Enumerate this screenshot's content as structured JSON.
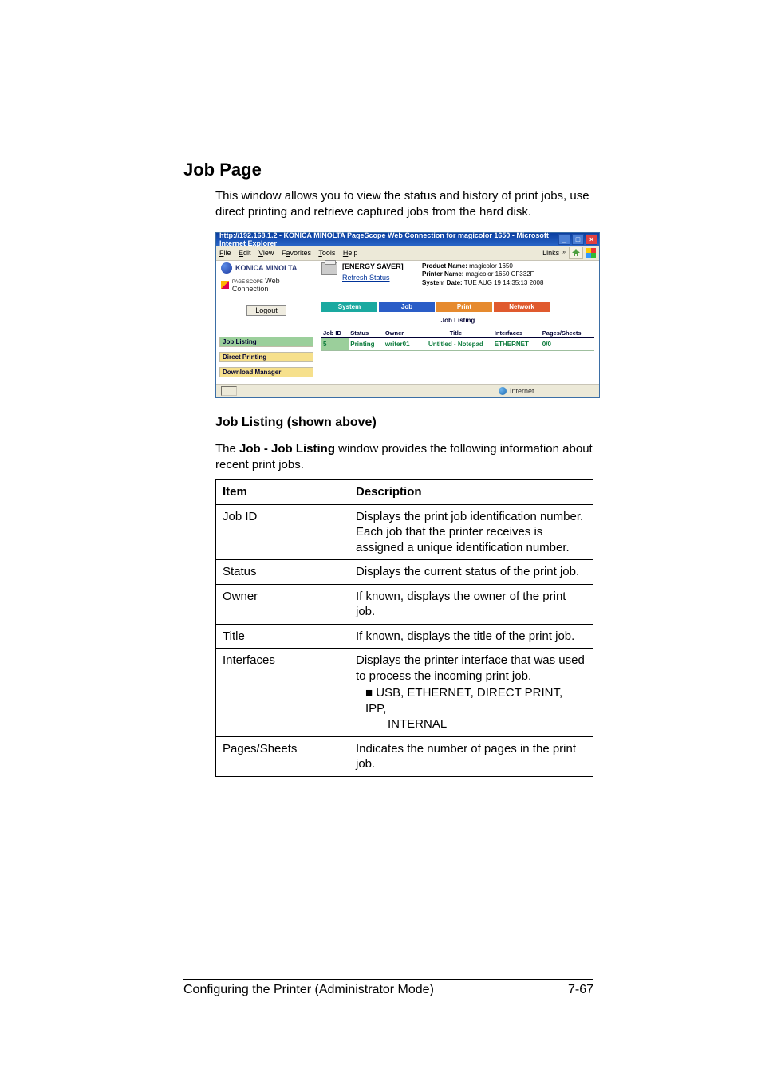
{
  "heading": "Job Page",
  "intro": "This window allows you to view the status and history of print jobs, use direct printing and retrieve captured jobs from the hard disk.",
  "screenshot": {
    "title": "http://192.168.1.2 - KONICA MINOLTA PageScope Web Connection for magicolor 1650 - Microsoft Internet Explorer",
    "menu": {
      "file": "File",
      "edit": "Edit",
      "view": "View",
      "favorites": "Favorites",
      "tools": "Tools",
      "help": "Help",
      "links": "Links"
    },
    "brand": {
      "km": "KONICA MINOLTA",
      "webconn": "Web Connection",
      "pagescope": "PAGE SCOPE"
    },
    "status_block": {
      "label": "[ENERGY SAVER]",
      "refresh": "Refresh Status"
    },
    "info": {
      "product_label": "Product Name:",
      "product": "magicolor 1650",
      "printer_label": "Printer Name:",
      "printer": "magicolor 1650 CF332F",
      "date_label": "System Date:",
      "date": "TUE AUG 19 14:35:13 2008"
    },
    "side": {
      "logout": "Logout",
      "job_listing": "Job Listing",
      "direct_printing": "Direct Printing",
      "download_manager": "Download Manager"
    },
    "tabs": {
      "system": "System",
      "job": "Job",
      "print": "Print",
      "network": "Network"
    },
    "panel_title": "Job Listing",
    "cols": {
      "job_id": "Job ID",
      "status": "Status",
      "owner": "Owner",
      "title": "Title",
      "interfaces": "Interfaces",
      "pages": "Pages/Sheets"
    },
    "row": {
      "job_id": "5",
      "status": "Printing",
      "owner": "writer01",
      "title": "Untitled - Notepad",
      "interfaces": "ETHERNET",
      "pages": "0/0"
    },
    "status_bar": {
      "zone": "Internet"
    }
  },
  "sub_heading": "Job Listing (shown above)",
  "para_lead": "The ",
  "para_bold": "Job - Job Listing",
  "para_tail": " window provides the following information about recent print jobs.",
  "table": {
    "h_item": "Item",
    "h_desc": "Description",
    "rows": {
      "job_id": {
        "item": "Job ID",
        "desc": "Displays the print job identification number. Each job that the printer receives is assigned a unique identification number."
      },
      "status": {
        "item": "Status",
        "desc": "Displays the current status of the print job."
      },
      "owner": {
        "item": "Owner",
        "desc": "If known, displays the owner of the print job."
      },
      "title": {
        "item": "Title",
        "desc": "If known, displays the title of the print job."
      },
      "interfaces": {
        "item": "Interfaces",
        "desc_line1": "Displays the printer interface that was used to process the incoming print job.",
        "bullet_line1": "USB, ETHERNET, DIRECT PRINT, IPP,",
        "bullet_line2": "INTERNAL"
      },
      "pages": {
        "item": "Pages/Sheets",
        "desc": "Indicates the number of pages in the print job."
      }
    }
  },
  "footer": {
    "left": "Configuring the Printer (Administrator Mode)",
    "right": "7-67"
  }
}
